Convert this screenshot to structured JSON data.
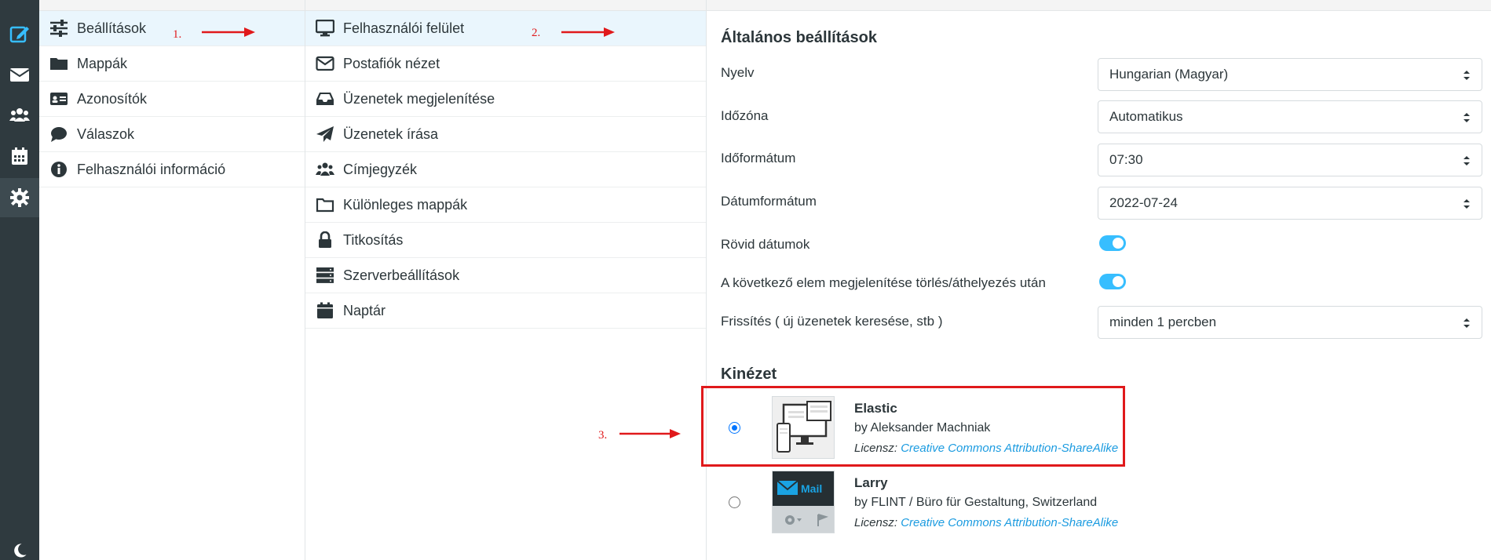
{
  "rail": {
    "items": [
      {
        "name": "compose-icon",
        "active": false
      },
      {
        "name": "mail-icon",
        "active": false
      },
      {
        "name": "contacts-icon",
        "active": false
      },
      {
        "name": "calendar-icon",
        "active": false
      },
      {
        "name": "settings-icon",
        "active": true
      },
      {
        "name": "dark-mode-icon",
        "active": false
      }
    ]
  },
  "settings_sections": [
    {
      "label": "Beállítások",
      "icon": "sliders-icon",
      "selected": true
    },
    {
      "label": "Mappák",
      "icon": "folder-icon",
      "selected": false
    },
    {
      "label": "Azonosítók",
      "icon": "id-card-icon",
      "selected": false
    },
    {
      "label": "Válaszok",
      "icon": "comment-icon",
      "selected": false
    },
    {
      "label": "Felhasználói információ",
      "icon": "info-icon",
      "selected": false
    }
  ],
  "preferences_sections": [
    {
      "label": "Felhasználói felület",
      "icon": "desktop-icon",
      "selected": true
    },
    {
      "label": "Postafiók nézet",
      "icon": "envelope-icon",
      "selected": false
    },
    {
      "label": "Üzenetek megjelenítése",
      "icon": "inbox-icon",
      "selected": false
    },
    {
      "label": "Üzenetek írása",
      "icon": "paper-plane-icon",
      "selected": false
    },
    {
      "label": "Címjegyzék",
      "icon": "users-icon",
      "selected": false
    },
    {
      "label": "Különleges mappák",
      "icon": "folder-outline-icon",
      "selected": false
    },
    {
      "label": "Titkosítás",
      "icon": "lock-icon",
      "selected": false
    },
    {
      "label": "Szerverbeállítások",
      "icon": "server-icon",
      "selected": false
    },
    {
      "label": "Naptár",
      "icon": "calendar-icon",
      "selected": false
    }
  ],
  "main": {
    "general_title": "Általános beállítások",
    "rows": [
      {
        "label": "Nyelv",
        "type": "select",
        "value": "Hungarian (Magyar)"
      },
      {
        "label": "Időzóna",
        "type": "select",
        "value": "Automatikus"
      },
      {
        "label": "Időformátum",
        "type": "select",
        "value": "07:30"
      },
      {
        "label": "Dátumformátum",
        "type": "select",
        "value": "2022-07-24"
      },
      {
        "label": "Rövid dátumok",
        "type": "toggle",
        "value": "on"
      },
      {
        "label": "A következő elem megjelenítése törlés/áthelyezés után",
        "type": "toggle",
        "value": "on"
      },
      {
        "label": "Frissítés ( új üzenetek keresése, stb )",
        "type": "select",
        "value": "minden 1 percben"
      }
    ],
    "skin_title": "Kinézet",
    "skins": [
      {
        "name": "Elastic",
        "author": "by Aleksander Machniak",
        "license_label": "Licensz:",
        "license_link": "Creative Commons Attribution-ShareAlike",
        "checked": true
      },
      {
        "name": "Larry",
        "author": "by FLINT / Büro für Gestaltung, Switzerland",
        "license_label": "Licensz:",
        "license_link": "Creative Commons Attribution-ShareAlike",
        "checked": false,
        "thumb_text": "Mail"
      }
    ]
  },
  "annotations": {
    "step1": "1.",
    "step2": "2.",
    "step3": "3.",
    "color": "#e0191b"
  },
  "colors": {
    "accent": "#37beff",
    "link": "#1b9be0",
    "rail": "#2f3a3f",
    "selected_row": "#eaf6fd"
  }
}
